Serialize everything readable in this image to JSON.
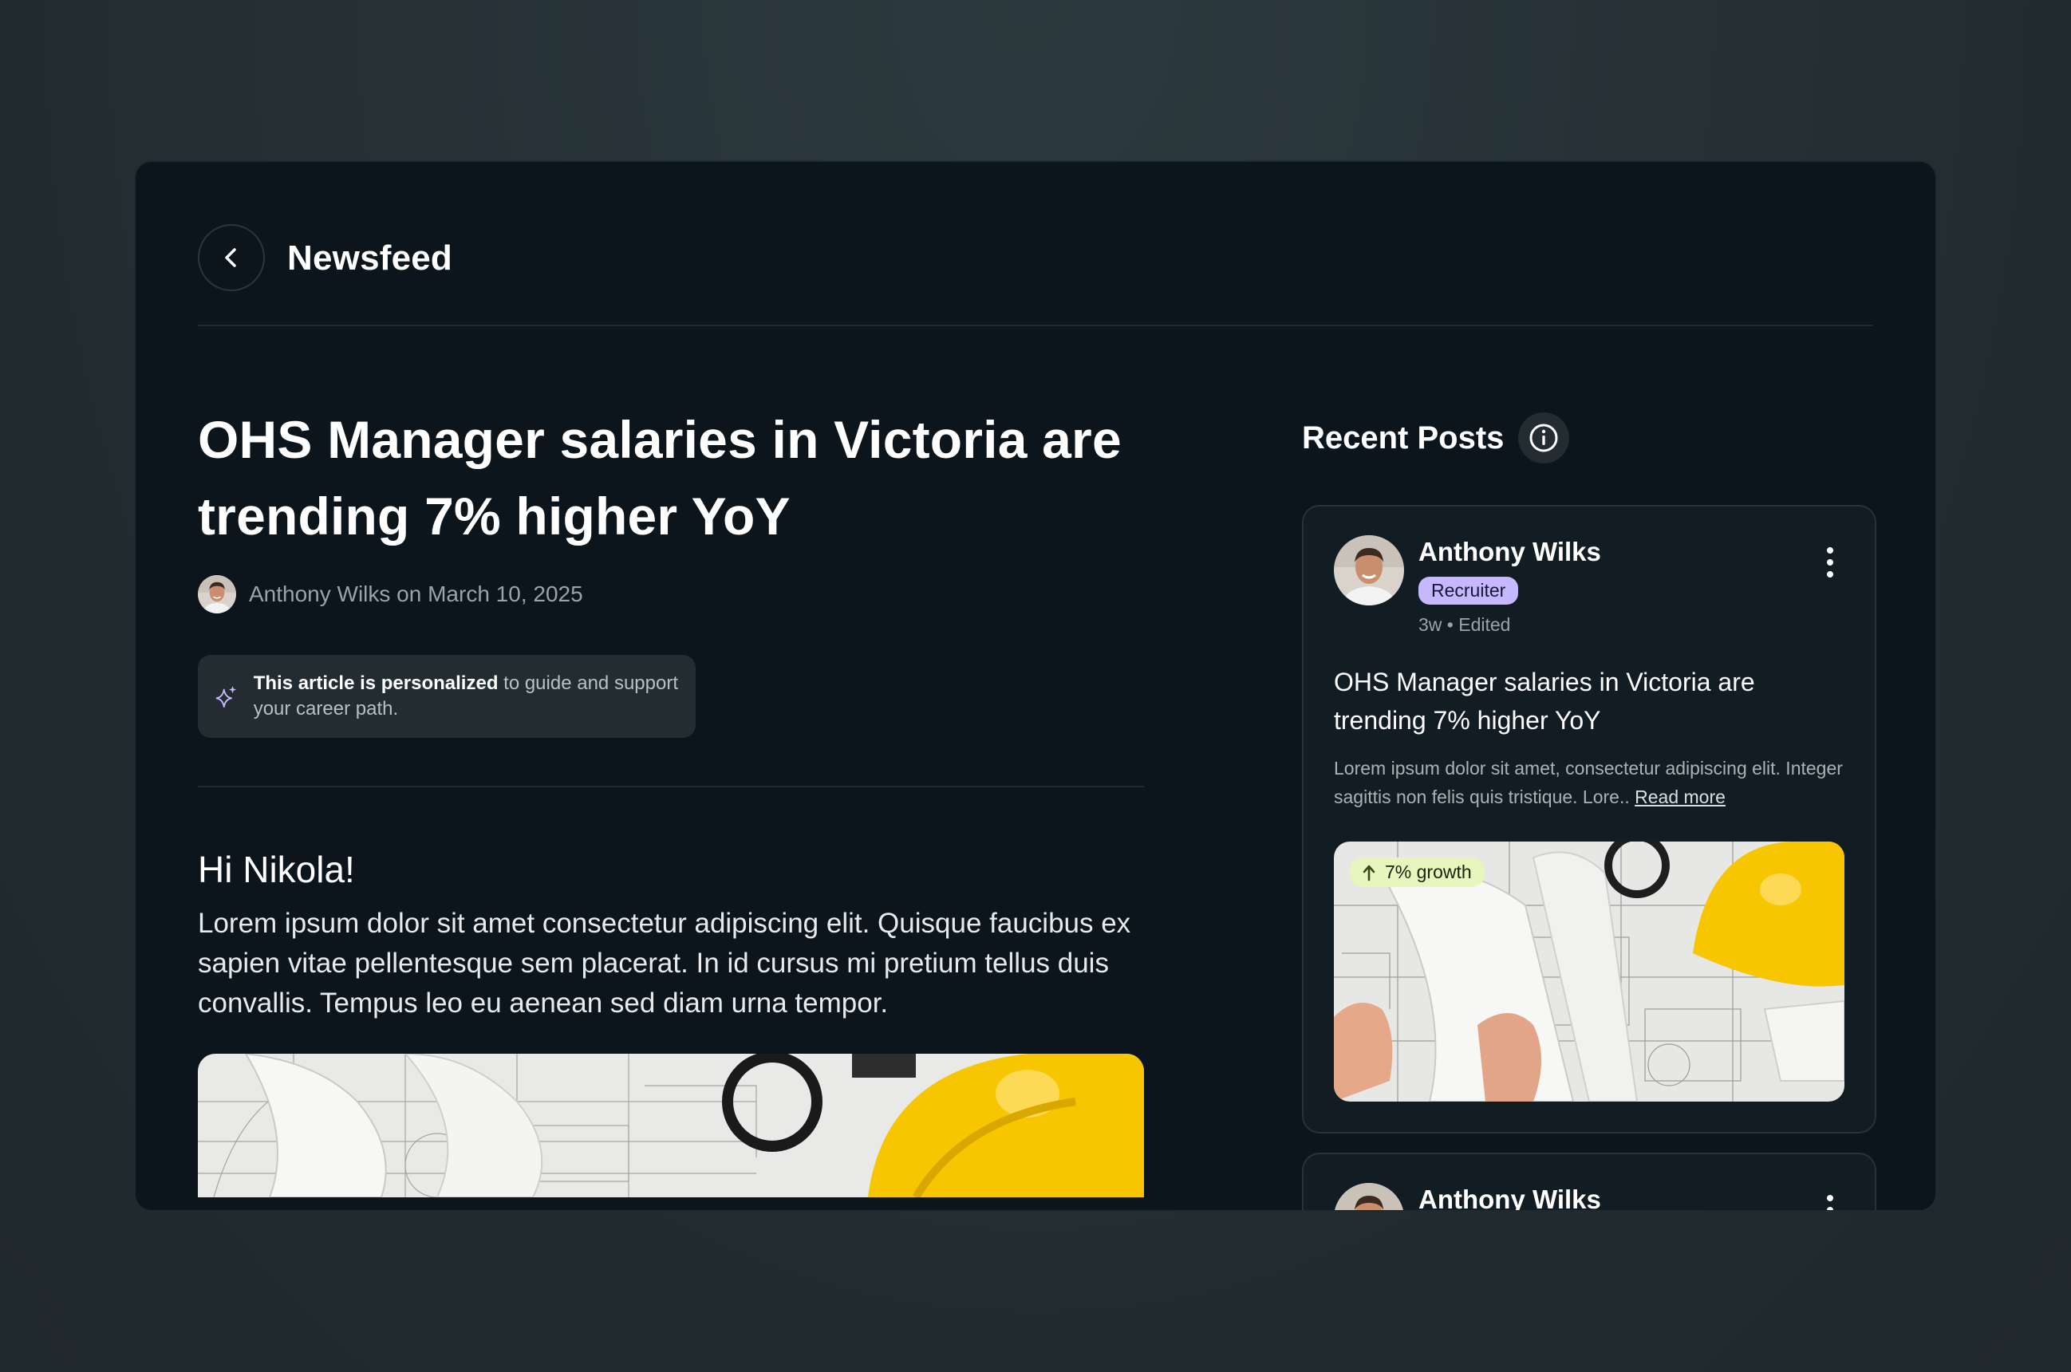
{
  "header": {
    "title": "Newsfeed",
    "back_icon": "chevron-left-icon"
  },
  "article": {
    "title": "OHS Manager salaries in Victoria are trending 7% higher YoY",
    "byline": "Anthony Wilks on March 10, 2025",
    "notice_strong": "This article is personalized",
    "notice_rest": " to guide and support your career path.",
    "notice_icon": "sparkle-icon",
    "greeting": "Hi Nikola!",
    "body": "Lorem ipsum dolor sit amet consectetur adipiscing elit. Quisque faucibus ex sapien vitae pellentesque sem placerat. In id cursus mi pretium tellus duis convallis. Tempus leo eu aenean sed diam urna tempor."
  },
  "sidebar": {
    "title": "Recent Posts",
    "info_icon": "info-icon",
    "posts": [
      {
        "author": "Anthony Wilks",
        "role": "Recruiter",
        "time": "3w • Edited",
        "title": "OHS Manager salaries in Victoria are trending 7% higher YoY",
        "excerpt": "Lorem ipsum dolor sit amet, consectetur adipiscing elit. Integer sagittis non felis quis tristique. Lore.. ",
        "read_more": "Read more",
        "badge": "7% growth"
      },
      {
        "author": "Anthony Wilks"
      }
    ]
  },
  "colors": {
    "window_bg": "#0b151b",
    "card_bg": "#121d23",
    "role_badge": "#c6b8ff",
    "growth_badge": "#e6f6bd",
    "helmet_yellow": "#f7c600"
  }
}
